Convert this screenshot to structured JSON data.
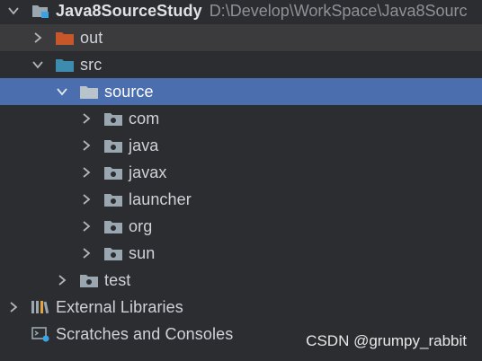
{
  "project": {
    "name": "Java8SourceStudy",
    "path": "D:\\Develop\\WorkSpace\\Java8Sourc",
    "expanded": true
  },
  "tree": {
    "out": {
      "label": "out",
      "expanded": false,
      "folder_color": "#c7562a"
    },
    "src": {
      "label": "src",
      "expanded": true,
      "folder_color": "#3d8cb0"
    },
    "source": {
      "label": "source",
      "expanded": true,
      "selected": true
    },
    "packages": [
      {
        "label": "com"
      },
      {
        "label": "java"
      },
      {
        "label": "javax"
      },
      {
        "label": "launcher"
      },
      {
        "label": "org"
      },
      {
        "label": "sun"
      }
    ],
    "test": {
      "label": "test",
      "expanded": false
    },
    "external_libraries": {
      "label": "External Libraries",
      "icon": "library-icon"
    },
    "scratches": {
      "label": "Scratches and Consoles",
      "icon": "scratches-icon"
    }
  },
  "watermark": "CSDN @grumpy_rabbit",
  "colors": {
    "background": "#2b2d30",
    "selection": "#4b6eaf",
    "hover_row": "#3b3b3e",
    "package_folder": "#9aa7b0"
  }
}
